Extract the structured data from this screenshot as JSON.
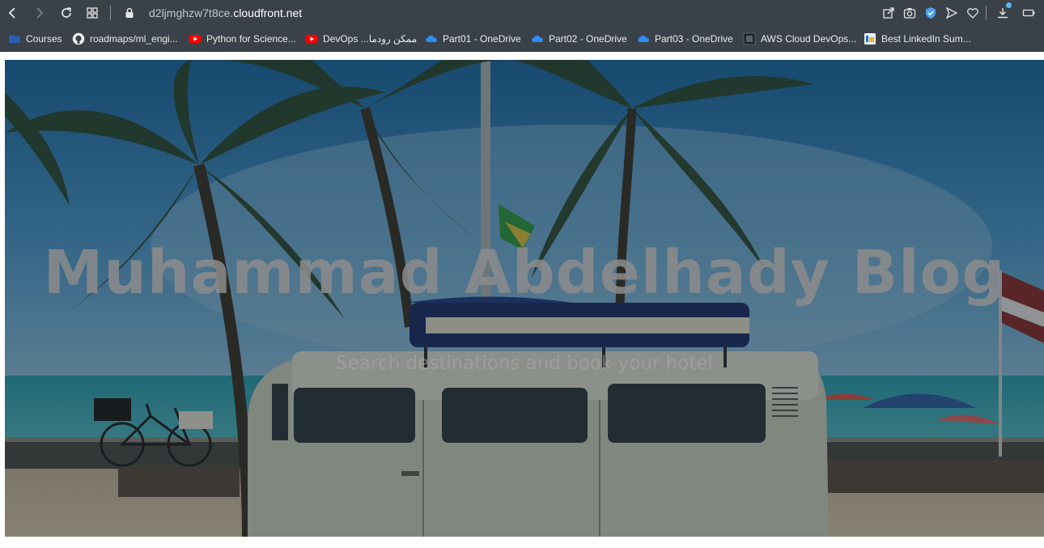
{
  "browser": {
    "url_subdomain": "d2ljmghzw7t8ce.",
    "url_domain": "cloudfront.net",
    "nav_icons": [
      "back-icon",
      "forward-icon",
      "reload-icon",
      "tabs-grid-icon"
    ],
    "toolbar_icons": [
      "share-icon",
      "camera-icon",
      "shield-icon",
      "send-icon",
      "heart-icon",
      "download-icon",
      "battery-icon"
    ],
    "accent_color": "#59b6f5"
  },
  "bookmarks": [
    {
      "label": "Courses",
      "icon": "folder-icon"
    },
    {
      "label": "roadmaps/ml_engi...",
      "icon": "github-icon"
    },
    {
      "label": "Python for Science...",
      "icon": "youtube-icon"
    },
    {
      "label": "DevOps ...ممكن رودما",
      "icon": "youtube-icon"
    },
    {
      "label": "Part01 - OneDrive",
      "icon": "onedrive-icon"
    },
    {
      "label": "Part02 - OneDrive",
      "icon": "onedrive-icon"
    },
    {
      "label": "Part03 - OneDrive",
      "icon": "onedrive-icon"
    },
    {
      "label": "AWS Cloud DevOps...",
      "icon": "aws-icon"
    },
    {
      "label": "Best LinkedIn Sum...",
      "icon": "linkedin-doc-icon"
    }
  ],
  "hero": {
    "title": "Muhammad Abdelhady Blog",
    "subtitle": "Search destinations and book your hotel"
  }
}
